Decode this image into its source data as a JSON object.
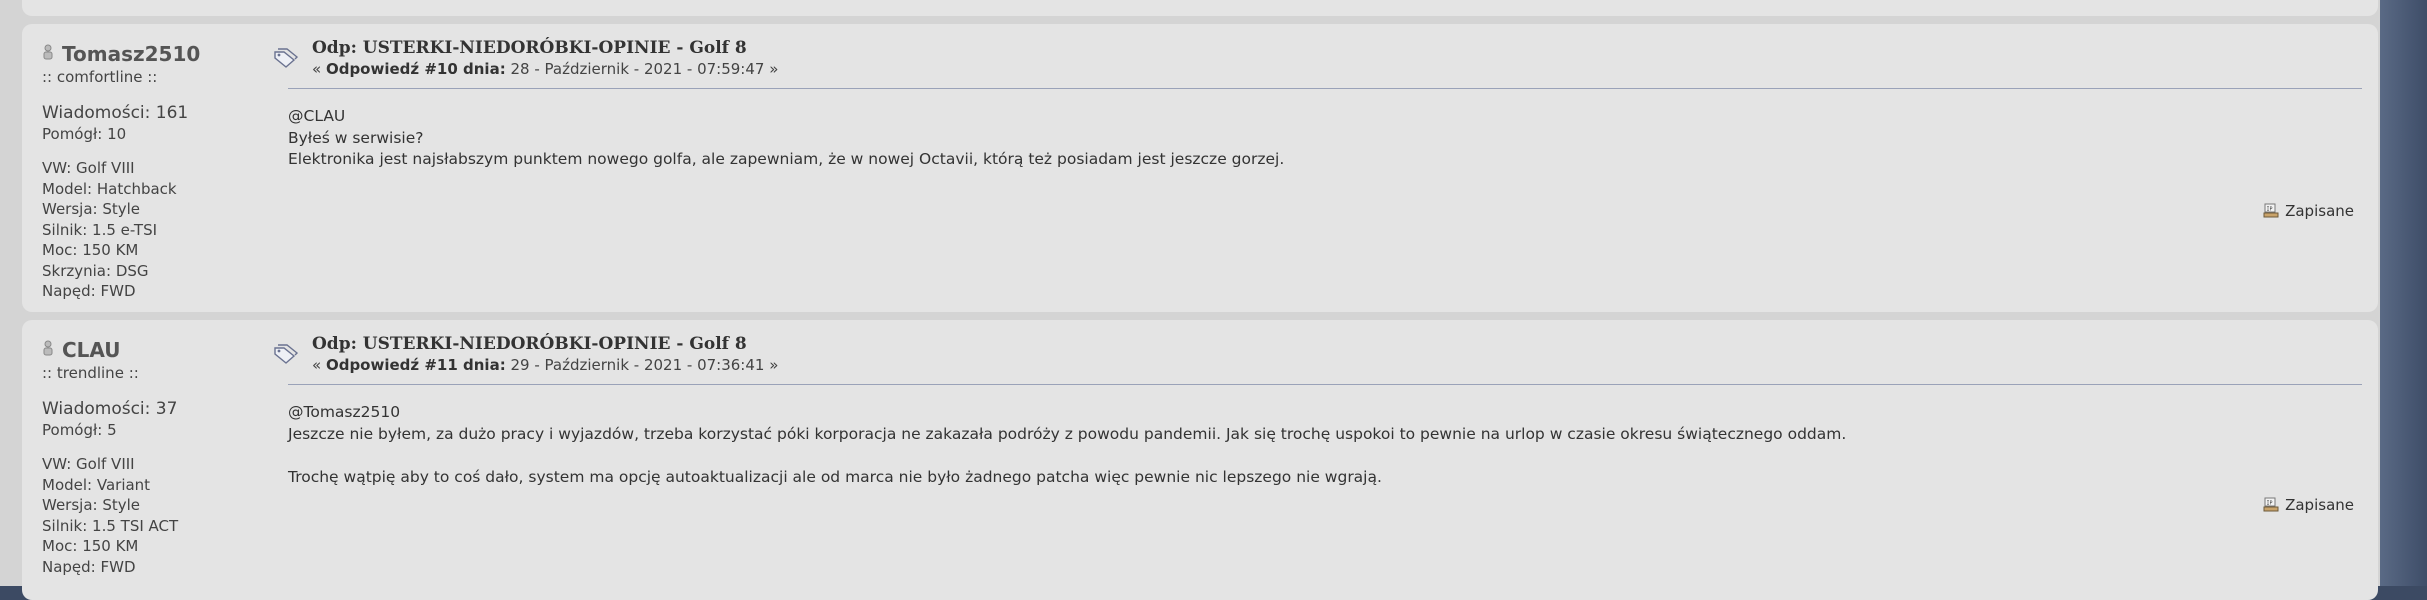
{
  "posts": [
    {
      "author": "Tomasz2510",
      "rank": ":: comfortline ::",
      "messages": "Wiadomości: 161",
      "helped": "Pomógł: 10",
      "specs": [
        "VW: Golf VIII",
        "Model: Hatchback",
        "Wersja: Style",
        "Silnik: 1.5 e-TSI",
        "Moc: 150 KM",
        "Skrzynia: DSG",
        "Napęd: FWD"
      ],
      "subject": "Odp: USTERKI-NIEDORÓBKI-OPINIE - Golf 8",
      "meta_prefix": "« ",
      "meta_bold": "Odpowiedź #10 dnia:",
      "meta_date": " 28 - Październik - 2021 - 07:59:47 »",
      "body": [
        "@CLAU",
        "Byłeś w serwisie?",
        "Elektronika jest najsłabszym punktem nowego golfa, ale zapewniam, że w nowej Octavii, którą też posiadam jest jeszcze gorzej."
      ],
      "saved_label": "Zapisane"
    },
    {
      "author": "CLAU",
      "rank": ":: trendline ::",
      "messages": "Wiadomości: 37",
      "helped": "Pomógł: 5",
      "specs": [
        "VW: Golf VIII",
        "Model: Variant",
        "Wersja: Style",
        "Silnik: 1.5 TSI ACT",
        "Moc: 150 KM",
        "Napęd: FWD"
      ],
      "subject": "Odp: USTERKI-NIEDORÓBKI-OPINIE - Golf 8",
      "meta_prefix": "« ",
      "meta_bold": "Odpowiedź #11 dnia:",
      "meta_date": " 29 - Październik - 2021 - 07:36:41 »",
      "body": [
        "@Tomasz2510",
        "Jeszcze nie byłem, za dużo pracy i wyjazdów, trzeba korzystać póki korporacja ne zakazała podróży z powodu pandemii. Jak się trochę uspokoi to pewnie na urlop w czasie okresu świątecznego oddam.",
        "",
        "Trochę wątpię aby to coś dało, system ma opcję autoaktualizacji ale od marca nie było żadnego patcha więc pewnie nic lepszego nie wgrają."
      ],
      "saved_label": "Zapisane"
    }
  ]
}
